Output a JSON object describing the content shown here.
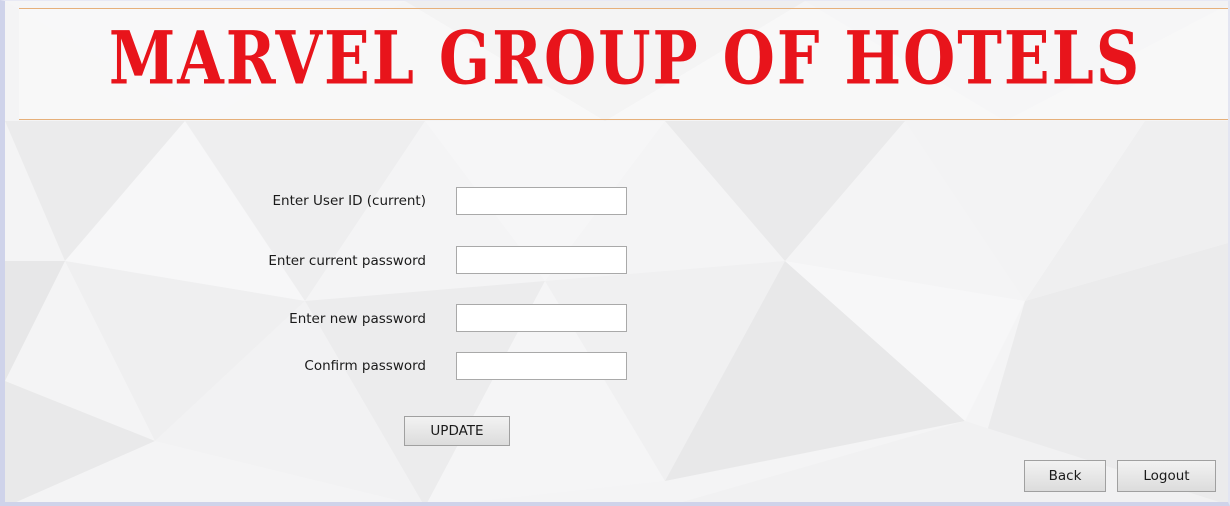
{
  "header": {
    "title": "MARVEL GROUP OF HOTELS"
  },
  "form": {
    "user_id_label": "Enter User ID (current)",
    "user_id_value": "",
    "current_password_label": "Enter current password",
    "current_password_value": "",
    "new_password_label": "Enter new password",
    "new_password_value": "",
    "confirm_password_label": "Confirm password",
    "confirm_password_value": "",
    "update_label": "UPDATE"
  },
  "footer": {
    "back_label": "Back",
    "logout_label": "Logout"
  },
  "colors": {
    "title": "#e8141b",
    "header_border": "#e6b07a"
  }
}
